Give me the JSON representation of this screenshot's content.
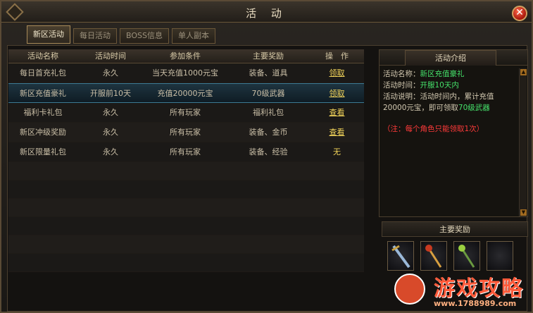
{
  "window": {
    "title": "活 动"
  },
  "tabs": [
    {
      "label": "新区活动",
      "active": true
    },
    {
      "label": "每日活动",
      "active": false
    },
    {
      "label": "BOSS信息",
      "active": false
    },
    {
      "label": "单人副本",
      "active": false
    }
  ],
  "table": {
    "headers": [
      "活动名称",
      "活动时间",
      "参加条件",
      "主要奖励",
      "操　作"
    ],
    "rows": [
      {
        "name": "每日首充礼包",
        "time": "永久",
        "cond": "当天充值1000元宝",
        "reward": "装备、道具",
        "action": "领取"
      },
      {
        "name": "新区充值豪礼",
        "time": "开服前10天",
        "cond": "充值20000元宝",
        "reward": "70级武器",
        "action": "领取"
      },
      {
        "name": "福利卡礼包",
        "time": "永久",
        "cond": "所有玩家",
        "reward": "福利礼包",
        "action": "查看"
      },
      {
        "name": "新区冲级奖励",
        "time": "永久",
        "cond": "所有玩家",
        "reward": "装备、金币",
        "action": "查看"
      },
      {
        "name": "新区限量礼包",
        "time": "永久",
        "cond": "所有玩家",
        "reward": "装备、经验",
        "action": "无"
      }
    ],
    "selected_row": 1
  },
  "intro": {
    "title": "活动介绍",
    "name_label": "活动名称：",
    "name_value": "新区充值豪礼",
    "time_label": "活动时间：",
    "time_value": "开服10天内",
    "desc_label": "活动说明：",
    "desc_text_1": "活动时间内，累计充值",
    "desc_text_2": "20000元宝，即可领取",
    "desc_highlight": "70级武器",
    "note": "（注：每个角色只能领取1次）"
  },
  "rewards": {
    "title": "主要奖励",
    "items": [
      "sword-icon",
      "staff-icon",
      "wand-icon",
      "empty-slot"
    ]
  },
  "watermark": {
    "text": "游戏攻略",
    "url": "www.1788989.com"
  },
  "colors": {
    "accent": "#f2d45a",
    "highlight": "#45e06a",
    "note": "#ff3a3a",
    "border": "#6a5638"
  }
}
